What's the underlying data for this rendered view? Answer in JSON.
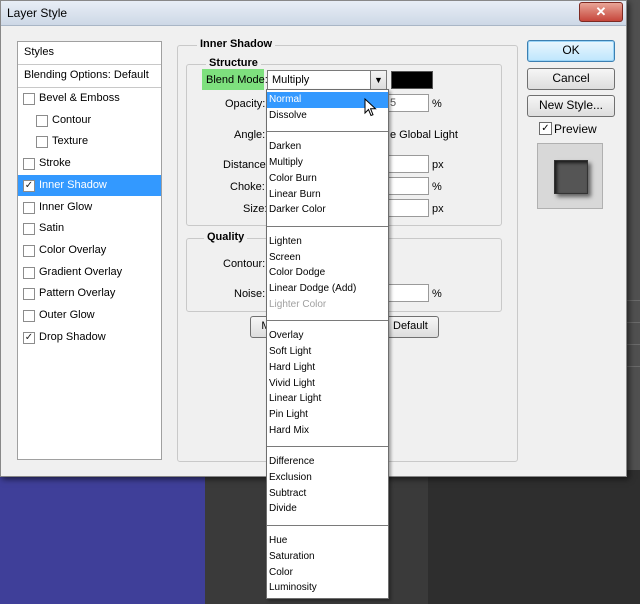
{
  "window": {
    "title": "Layer Style",
    "close_glyph": "✕"
  },
  "styles_list": {
    "header": "Styles",
    "blending": "Blending Options: Default",
    "items": [
      {
        "label": "Bevel & Emboss",
        "checked": false
      },
      {
        "label": "Contour",
        "checked": false
      },
      {
        "label": "Texture",
        "checked": false
      },
      {
        "label": "Stroke",
        "checked": false
      },
      {
        "label": "Inner Shadow",
        "checked": true
      },
      {
        "label": "Inner Glow",
        "checked": false
      },
      {
        "label": "Satin",
        "checked": false
      },
      {
        "label": "Color Overlay",
        "checked": false
      },
      {
        "label": "Gradient Overlay",
        "checked": false
      },
      {
        "label": "Pattern Overlay",
        "checked": false
      },
      {
        "label": "Outer Glow",
        "checked": false
      },
      {
        "label": "Drop Shadow",
        "checked": true
      }
    ],
    "selected": "Inner Shadow"
  },
  "inner_shadow": {
    "title": "Inner Shadow",
    "structure_title": "Structure",
    "blend_mode_label": "Blend Mode:",
    "blend_mode_value": "Multiply",
    "opacity_label": "Opacity:",
    "opacity_fragment": "5",
    "percent": "%",
    "angle_label": "Angle:",
    "global_light_fragment": "e Global Light",
    "distance_label": "Distance:",
    "choke_label": "Choke:",
    "size_label": "Size:",
    "px": "px",
    "quality_title": "Quality",
    "contour_label": "Contour:",
    "noise_label": "Noise:",
    "make_default_fragment": "M",
    "reset_default_fragment": "Default",
    "shadow_color": "#000000"
  },
  "buttons": {
    "ok": "OK",
    "cancel": "Cancel",
    "new_style": "New Style...",
    "preview": "Preview"
  },
  "preview_checked": true,
  "dropdown": {
    "groups": [
      [
        {
          "label": "Normal",
          "state": "highlighted"
        },
        {
          "label": "Dissolve",
          "state": "normal"
        }
      ],
      [
        {
          "label": "Darken",
          "state": "normal"
        },
        {
          "label": "Multiply",
          "state": "normal"
        },
        {
          "label": "Color Burn",
          "state": "normal"
        },
        {
          "label": "Linear Burn",
          "state": "normal"
        },
        {
          "label": "Darker Color",
          "state": "normal"
        }
      ],
      [
        {
          "label": "Lighten",
          "state": "normal"
        },
        {
          "label": "Screen",
          "state": "normal"
        },
        {
          "label": "Color Dodge",
          "state": "normal"
        },
        {
          "label": "Linear Dodge (Add)",
          "state": "normal"
        },
        {
          "label": "Lighter Color",
          "state": "disabled"
        }
      ],
      [
        {
          "label": "Overlay",
          "state": "normal"
        },
        {
          "label": "Soft Light",
          "state": "normal"
        },
        {
          "label": "Hard Light",
          "state": "normal"
        },
        {
          "label": "Vivid Light",
          "state": "normal"
        },
        {
          "label": "Linear Light",
          "state": "normal"
        },
        {
          "label": "Pin Light",
          "state": "normal"
        },
        {
          "label": "Hard Mix",
          "state": "normal"
        }
      ],
      [
        {
          "label": "Difference",
          "state": "normal"
        },
        {
          "label": "Exclusion",
          "state": "normal"
        },
        {
          "label": "Subtract",
          "state": "normal"
        },
        {
          "label": "Divide",
          "state": "normal"
        }
      ],
      [
        {
          "label": "Hue",
          "state": "normal"
        },
        {
          "label": "Saturation",
          "state": "normal"
        },
        {
          "label": "Color",
          "state": "normal"
        },
        {
          "label": "Luminosity",
          "state": "normal"
        }
      ]
    ]
  }
}
